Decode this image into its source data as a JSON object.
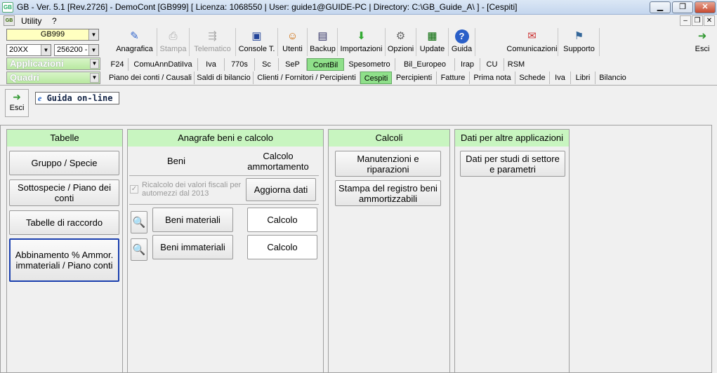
{
  "window": {
    "title": "GB - Ver. 5.1 [Rev.2726] -  DemoCont [GB999]     [ Licenza: 1068550 | User: guide1@GUIDE-PC | Directory: C:\\GB_Guide_A\\ ] - [Cespiti]"
  },
  "menubar": {
    "items": [
      "Utility",
      "?"
    ]
  },
  "company": {
    "code": "GB999",
    "year": "20XX",
    "account": "256200 -"
  },
  "dropdowns": {
    "applicazioni": "Applicazioni",
    "quadri": "Quadri"
  },
  "toolbar": {
    "buttons": [
      "Anagrafica",
      "Stampa",
      "Telematico",
      "Console T.",
      "Utenti",
      "Backup",
      "Importazioni",
      "Opzioni",
      "Update",
      "Guida",
      "Comunicazioni",
      "Supporto",
      "Esci"
    ]
  },
  "tabs_row1": [
    "F24",
    "ComuAnnDatiIva",
    "Iva",
    "770s",
    "Sc",
    "SeP",
    "ContBil",
    "Spesometro",
    "Bil_Europeo",
    "Irap",
    "CU",
    "RSM"
  ],
  "tabs_row2": [
    "Piano dei conti / Causali",
    "Saldi di bilancio",
    "Clienti / Fornitori / Percipienti",
    "Cespiti",
    "Percipienti",
    "Fatture",
    "Prima nota",
    "Schede",
    "Iva",
    "Libri",
    "Bilancio"
  ],
  "form_toolbar": {
    "esci": "Esci",
    "guida_online": "Guida on-line"
  },
  "tabelle": {
    "header": "Tabelle",
    "buttons": [
      "Gruppo / Specie",
      "Sottospecie / Piano dei conti",
      "Tabelle di raccordo",
      "Abbinamento % Ammor. immateriali / Piano conti"
    ]
  },
  "anagrafe": {
    "header": "Anagrafe beni e calcolo",
    "col_beni": "Beni",
    "col_calcolo": "Calcolo ammortamento",
    "checkbox_label": "Ricalcolo dei valori fiscali per automezzi dal 2013",
    "aggiorna": "Aggiorna dati",
    "beni_materiali": "Beni materiali",
    "beni_immateriali": "Beni immateriali",
    "calcolo": "Calcolo"
  },
  "calcoli": {
    "header": "Calcoli",
    "buttons": [
      "Manutenzioni e riparazioni",
      "Stampa del registro beni ammortizzabili"
    ]
  },
  "dati": {
    "header": "Dati per altre applicazioni",
    "buttons": [
      "Dati per studi di settore e parametri"
    ]
  }
}
